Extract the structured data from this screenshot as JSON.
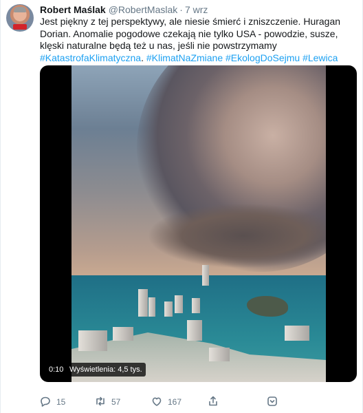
{
  "author": {
    "name": "Robert Maślak",
    "handle": "@RobertMaslak",
    "separator": "·",
    "timestamp": "7 wrz"
  },
  "tweet": {
    "text_intro": "Jest piękny z tej perspektywy, ale niesie śmierć i zniszczenie. Huragan Dorian. Anomalie pogodowe czekają nie tylko USA - powodzie, susze, klęski naturalne będą też u nas, jeśli nie powstrzymamy ",
    "hashtags": [
      "#KatastrofaKlimatyczna",
      "#KlimatNaZmiane",
      "#EkologDoSejmu",
      "#Lewica"
    ],
    "hashtag_separator_1": ". ",
    "hashtag_separator_2": " ",
    "hashtag_separator_3": " ",
    "hashtag_color": "#1da1f2"
  },
  "video": {
    "elapsed": "0:10",
    "views": "Wyświetlenia: 4,5 tys."
  },
  "actions": {
    "reply_count": "15",
    "retweet_count": "57",
    "like_count": "167",
    "reply_icon": "reply-icon",
    "retweet_icon": "retweet-icon",
    "like_icon": "heart-icon",
    "share_icon": "share-icon",
    "more_icon": "chevron-down-icon"
  }
}
